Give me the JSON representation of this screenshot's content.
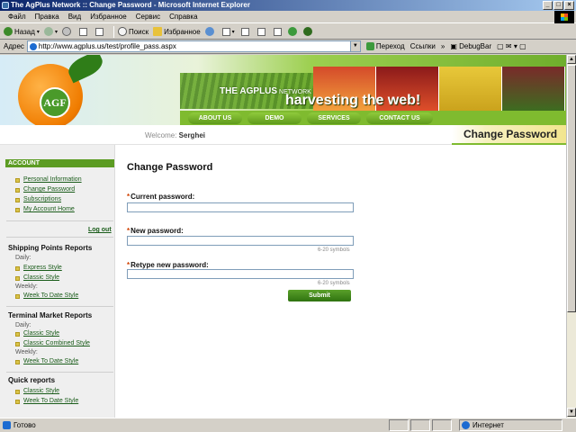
{
  "window": {
    "title": "The AgPlus Network :: Change Password - Microsoft Internet Explorer"
  },
  "menu": [
    "Файл",
    "Правка",
    "Вид",
    "Избранное",
    "Сервис",
    "Справка"
  ],
  "toolbar": {
    "back": "Назад",
    "search": "Поиск",
    "favorites": "Избранное"
  },
  "address": {
    "label": "Адрес",
    "url": "http://www.agplus.us/test/profile_pass.aspx",
    "go": "Переход",
    "links": "Ссылки",
    "debugbar": "DebugBar"
  },
  "banner": {
    "logo": "AGF",
    "tagline_a": "THE AGPLUS",
    "tagline_b": " NETWORK",
    "tagline_main": "harvesting the web!",
    "nav": [
      "ABOUT US",
      "DEMO",
      "SERVICES",
      "CONTACT US"
    ]
  },
  "welcome": {
    "label": "Welcome:",
    "user": "Serghei",
    "page_title": "Change Password"
  },
  "sidebar": {
    "account_header": "ACCOUNT",
    "account_links": [
      "Personal Information",
      "Change Password",
      "Subscriptions",
      "My Account Home"
    ],
    "logout": "Log out",
    "shipping": {
      "title": "Shipping Points Reports",
      "daily": "Daily:",
      "daily_links": [
        "Express Style",
        "Classic Style"
      ],
      "weekly": "Weekly:",
      "weekly_links": [
        "Week To Date Style"
      ]
    },
    "terminal": {
      "title": "Terminal Market Reports",
      "daily": "Daily:",
      "daily_links": [
        "Classic Style",
        "Classic Combined Style"
      ],
      "weekly": "Weekly:",
      "weekly_links": [
        "Week To Date Style"
      ]
    },
    "quick": {
      "title": "Quick reports",
      "links": [
        "Classic Style",
        "Week To Date Style"
      ]
    }
  },
  "form": {
    "title": "Change Password",
    "current_label": "Current password:",
    "new_label": "New password:",
    "retype_label": "Retype new password:",
    "hint": "6-20 symbols",
    "submit": "Submit"
  },
  "status": {
    "text": "Готово",
    "zone": "Интернет"
  },
  "colors": {
    "brand_green": "#5c9c23",
    "link_green": "#1a5c1a",
    "required": "#d04000"
  }
}
